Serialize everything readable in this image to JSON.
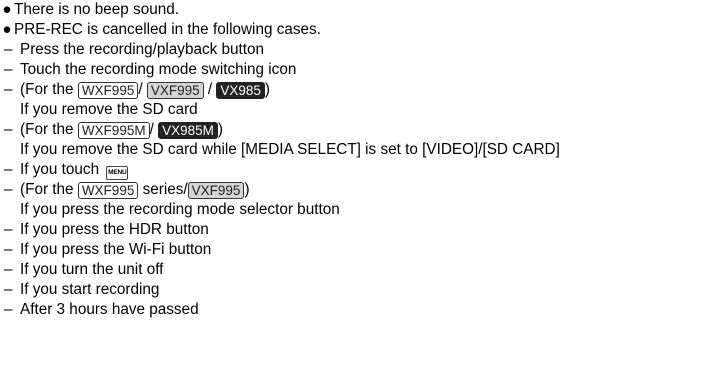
{
  "bullets": [
    "There is no beep sound.",
    "PRE-REC is cancelled in the following cases."
  ],
  "items": {
    "press_rec": "Press the recording/playback button",
    "touch_mode": "Touch the recording mode switching icon",
    "for_the_1": "(For the ",
    "badge_wxf995": "WXF995",
    "badge_vxf995": "VXF995",
    "badge_vx985": "VX985",
    "close_paren": ")",
    "slash": "/",
    "remove_sd": "If you remove the SD card",
    "for_the_2": "(For the ",
    "badge_wxf995m": "WXF995M",
    "badge_vx985m": "VX985M",
    "remove_sd_media": "If you remove the SD card while [MEDIA SELECT] is set to [VIDEO]/[SD CARD]",
    "touch_menu": "If you touch ",
    "menu_icon_text": "MENU",
    "for_the_3": "(For the ",
    "series": " series/",
    "press_mode_selector": "If you press the recording mode selector button",
    "press_hdr": "If you press the HDR button",
    "press_wifi": "If you press the Wi-Fi button",
    "turn_off": "If you turn the unit off",
    "start_rec": "If you start recording",
    "three_hours": "After 3 hours have passed"
  },
  "symbols": {
    "bullet": "●",
    "dash": "–"
  }
}
